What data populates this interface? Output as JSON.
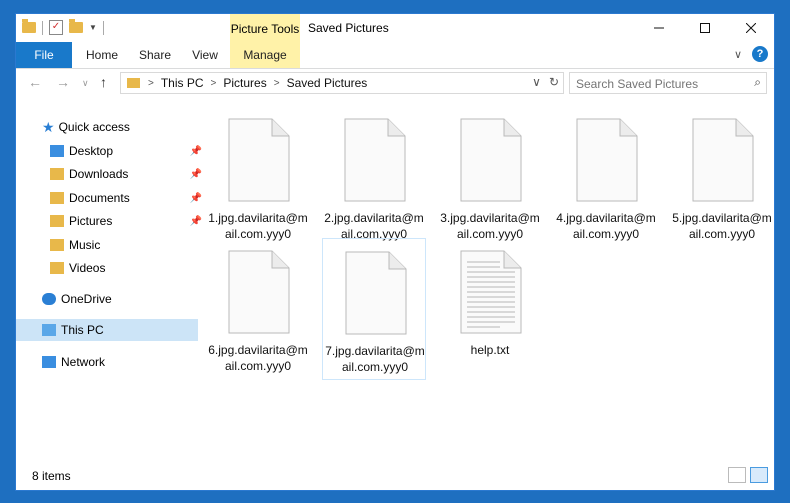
{
  "window": {
    "title": "Saved Pictures"
  },
  "ribbon": {
    "contextual_group": "Picture Tools",
    "tabs": [
      "File",
      "Home",
      "Share",
      "View",
      "Manage"
    ]
  },
  "address": {
    "crumbs": [
      "This PC",
      "Pictures",
      "Saved Pictures"
    ]
  },
  "search": {
    "placeholder": "Search Saved Pictures"
  },
  "navigation": {
    "items": [
      {
        "label": "Quick access",
        "icon": "star-icon"
      },
      {
        "label": "Desktop",
        "icon": "desktop-folder-icon",
        "pinned": true
      },
      {
        "label": "Downloads",
        "icon": "downloads-folder-icon",
        "pinned": true
      },
      {
        "label": "Documents",
        "icon": "documents-folder-icon",
        "pinned": true
      },
      {
        "label": "Pictures",
        "icon": "pictures-folder-icon",
        "pinned": true
      },
      {
        "label": "Music",
        "icon": "music-folder-icon"
      },
      {
        "label": "Videos",
        "icon": "videos-folder-icon"
      },
      {
        "label": "OneDrive",
        "icon": "cloud-icon"
      },
      {
        "label": "This PC",
        "icon": "computer-icon",
        "selected": true
      },
      {
        "label": "Network",
        "icon": "network-icon"
      }
    ]
  },
  "files": [
    {
      "name": "1.jpg.davilarita@mail.com.yyy0",
      "type": "blank"
    },
    {
      "name": "2.jpg.davilarita@mail.com.yyy0",
      "type": "blank"
    },
    {
      "name": "3.jpg.davilarita@mail.com.yyy0",
      "type": "blank"
    },
    {
      "name": "4.jpg.davilarita@mail.com.yyy0",
      "type": "blank"
    },
    {
      "name": "5.jpg.davilarita@mail.com.yyy0",
      "type": "blank"
    },
    {
      "name": "6.jpg.davilarita@mail.com.yyy0",
      "type": "blank"
    },
    {
      "name": "7.jpg.davilarita@mail.com.yyy0",
      "type": "blank",
      "highlighted": true
    },
    {
      "name": "help.txt",
      "type": "text"
    }
  ],
  "status": {
    "item_count": "8 items"
  },
  "colors": {
    "accent": "#1979ca",
    "selection": "#cce4f7",
    "picture_tools": "#fff2a8"
  }
}
